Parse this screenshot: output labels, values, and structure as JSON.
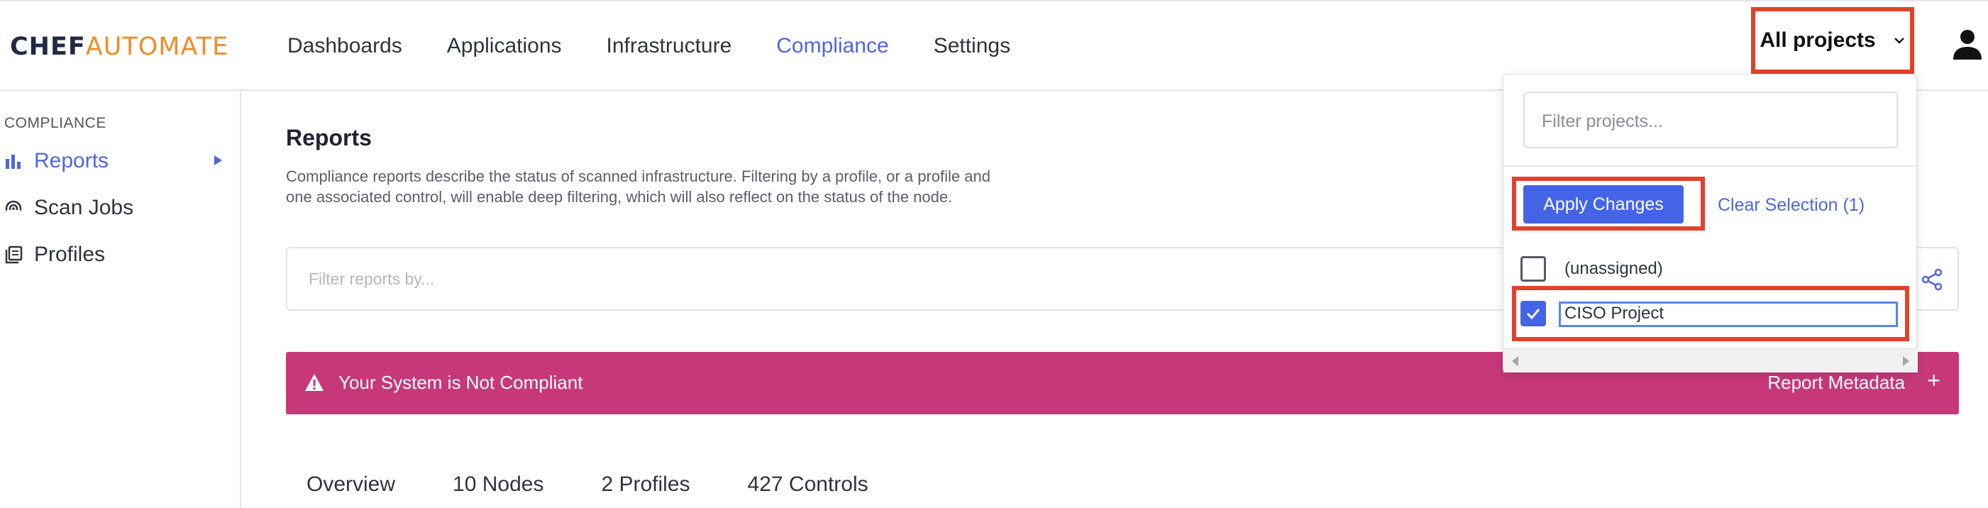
{
  "brand": {
    "part1": "CHEF",
    "part2": "AUTOMATE"
  },
  "nav": [
    "Dashboards",
    "Applications",
    "Infrastructure",
    "Compliance",
    "Settings"
  ],
  "nav_active": "Compliance",
  "projects": {
    "label": "All projects",
    "icon": "chevron-down-icon"
  },
  "user": {
    "icon": "user-icon"
  },
  "sidebar": {
    "heading": "COMPLIANCE",
    "items": [
      {
        "label": "Reports",
        "icon": "bar-chart-icon",
        "active": true
      },
      {
        "label": "Scan Jobs",
        "icon": "radar-icon",
        "active": false
      },
      {
        "label": "Profiles",
        "icon": "library-icon",
        "active": false
      }
    ]
  },
  "main": {
    "title": "Reports",
    "description_line1": "Compliance reports describe the status of scanned infrastructure. Filtering by a profile, or a profile and",
    "description_line2": "one associated control, will enable deep filtering, which will also reflect on the status of the node.",
    "filter_placeholder": "Filter reports by...",
    "alert": {
      "text": "Your System is Not Compliant",
      "meta": "Report Metadata",
      "plus": "+"
    },
    "tabs": [
      "Overview",
      "10 Nodes",
      "2 Profiles",
      "427 Controls"
    ]
  },
  "dropdown": {
    "search_placeholder": "Filter projects...",
    "apply_label": "Apply Changes",
    "clear_label": "Clear Selection (1)",
    "options": [
      {
        "label": "(unassigned)",
        "checked": false
      },
      {
        "label": "CISO Project",
        "checked": true
      }
    ]
  },
  "colors": {
    "accent": "#4f66e0",
    "brand_orange": "#f38b27",
    "alert": "#c7387a",
    "highlight": "#e2412b",
    "button": "#4464e8"
  }
}
